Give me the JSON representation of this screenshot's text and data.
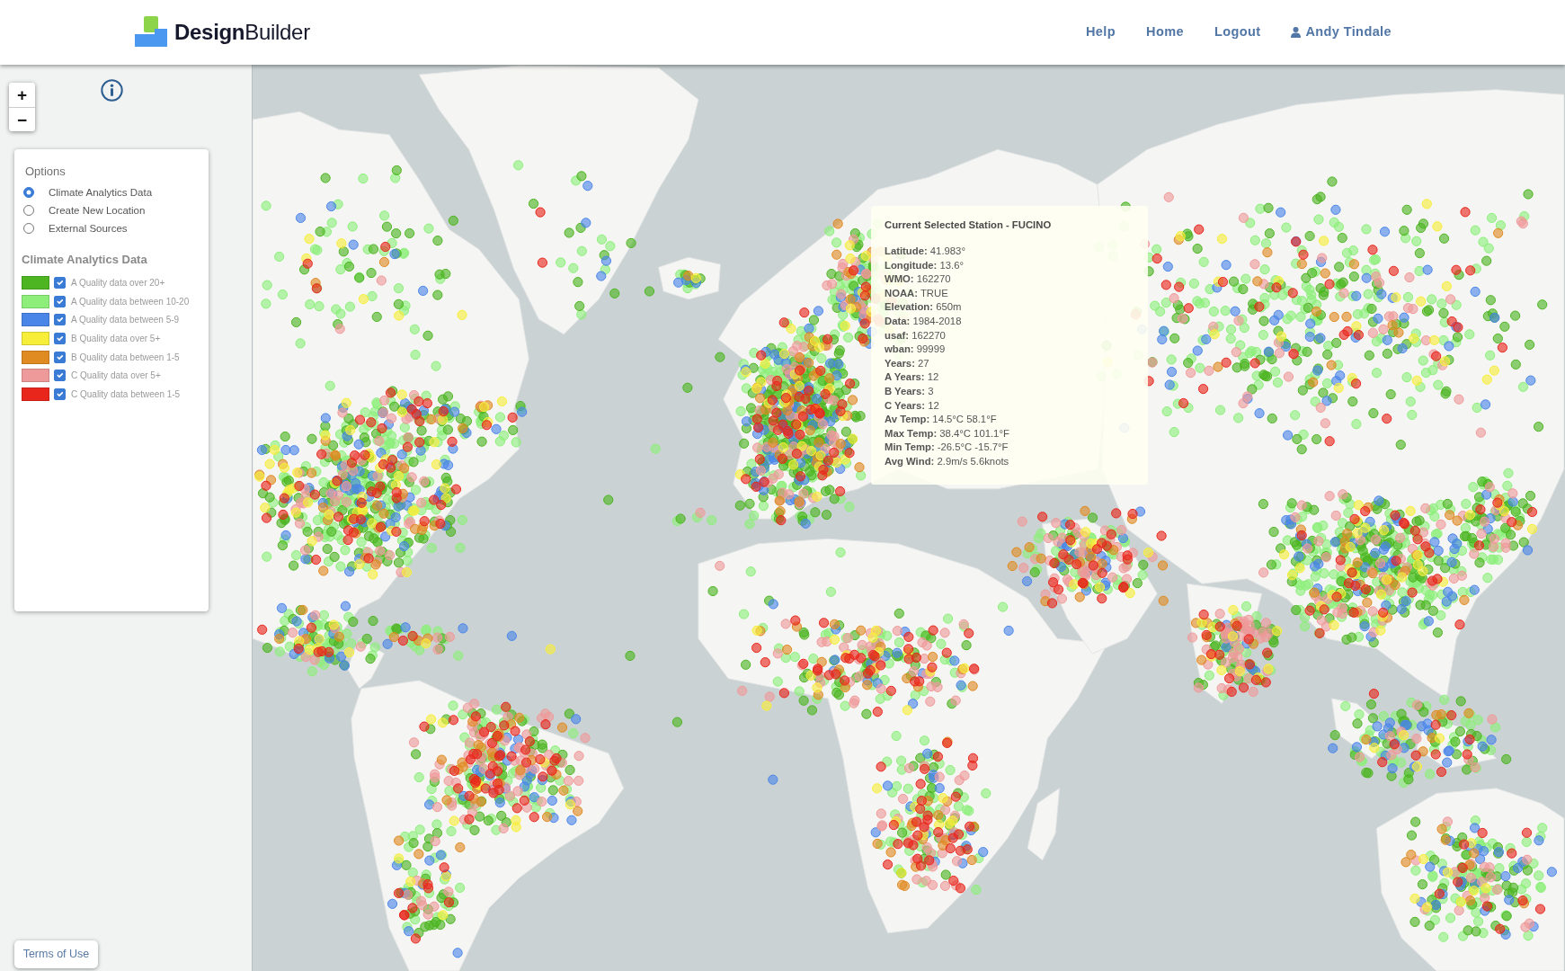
{
  "header": {
    "logo_text": "**Design**Builder",
    "nav_links": [
      {
        "label": "Help",
        "kind": "link"
      },
      {
        "label": "Home",
        "kind": "link"
      },
      {
        "label": "Logout",
        "kind": "link"
      },
      {
        "label": "Andy Tindale",
        "kind": "user"
      }
    ]
  },
  "map_controls": {
    "zoom_in": "+",
    "zoom_out": "−"
  },
  "options_panel": {
    "title": "Options",
    "choices": [
      {
        "label": "Climate Analytics Data",
        "selected": true
      },
      {
        "label": "Create New Location",
        "selected": false
      },
      {
        "label": "External Sources",
        "selected": false
      }
    ],
    "legend_title": "Climate Analytics Data",
    "legend": [
      {
        "label": "A Quality data over 20+",
        "color": "#4cb521",
        "checked": true
      },
      {
        "label": "A Quality data between 10-20",
        "color": "#8def7a",
        "checked": true
      },
      {
        "label": "A Quality data between 5-9",
        "color": "#4a86e8",
        "checked": true
      },
      {
        "label": "B Quality data over 5+",
        "color": "#f7ee3a",
        "checked": true
      },
      {
        "label": "B Quality data between 1-5",
        "color": "#e08a22",
        "checked": true
      },
      {
        "label": "C Quality data over 5+",
        "color": "#ef9a9a",
        "checked": true
      },
      {
        "label": "C Quality data between 1-5",
        "color": "#e8261c",
        "checked": true
      }
    ]
  },
  "station_popup": {
    "title": "Current Selected Station - FUCINO",
    "fields": [
      "**Latitude:** 41.983°",
      "**Longitude:** 13.6°",
      "**WMO:** 162270",
      "**NOAA:** TRUE",
      "**Elevation:** 650m",
      "**Data:** 1984-2018",
      "**usaf:** 162270",
      "**wban:** 99999",
      "**Years:** 27",
      "**A Years:** 12",
      "**B Years:** 3",
      "**C Years:** 12",
      "**Av Temp:** 14.5°C 58.1°F",
      "**Max Temp:** 38.4°C 101.1°F",
      "**Min Temp:** -26.5°C -15.7°F",
      "**Avg Wind:** 2.9m/s 5.6knots"
    ]
  },
  "footer_link": "Terms of Use"
}
